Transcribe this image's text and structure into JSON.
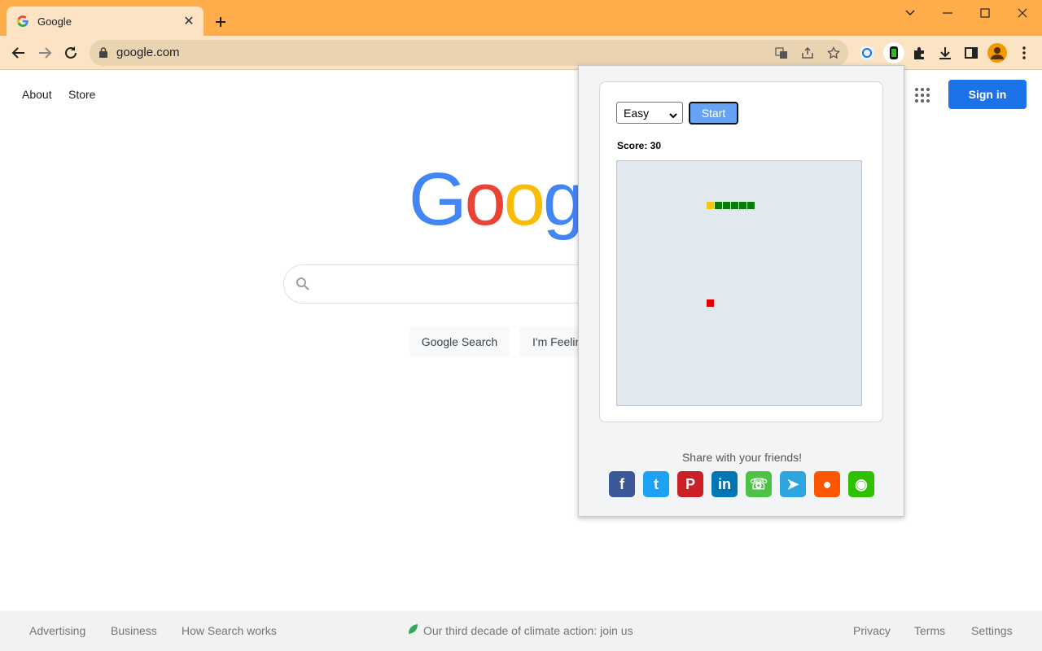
{
  "browser": {
    "tab_title": "Google",
    "tab_close_glyph": "✕",
    "url": "google.com"
  },
  "google": {
    "header_links": [
      "About",
      "Store"
    ],
    "signin_label": "Sign in",
    "logo_letters": [
      {
        "ch": "G",
        "color": "#4285f4"
      },
      {
        "ch": "o",
        "color": "#ea4335"
      },
      {
        "ch": "o",
        "color": "#fbbc05"
      },
      {
        "ch": "g",
        "color": "#4285f4"
      }
    ],
    "search_button": "Google Search",
    "lucky_button": "I'm Feelin",
    "footer": {
      "advertising": "Advertising",
      "business": "Business",
      "how_search_works": "How Search works",
      "climate": "Our third decade of climate action: join us",
      "privacy": "Privacy",
      "terms": "Terms",
      "settings": "Settings"
    }
  },
  "popup": {
    "difficulty_selected": "Easy",
    "start_label": "Start",
    "score_text": "Score: 30",
    "share_text": "Share with your friends!",
    "snake_colors": {
      "head": "#f5c518",
      "body": "#0a7a0a",
      "food": "#e00000"
    },
    "social": [
      {
        "name": "facebook",
        "glyph": "f",
        "color": "#3b5998"
      },
      {
        "name": "twitter",
        "glyph": "t",
        "color": "#1da1f2"
      },
      {
        "name": "pinterest",
        "glyph": "P",
        "color": "#cb2027"
      },
      {
        "name": "linkedin",
        "glyph": "in",
        "color": "#0077b5"
      },
      {
        "name": "whatsapp",
        "glyph": "☏",
        "color": "#4dc247"
      },
      {
        "name": "telegram",
        "glyph": "➤",
        "color": "#2ca5e0"
      },
      {
        "name": "reddit",
        "glyph": "●",
        "color": "#ff5700"
      },
      {
        "name": "wechat",
        "glyph": "◉",
        "color": "#2dc100"
      }
    ]
  }
}
